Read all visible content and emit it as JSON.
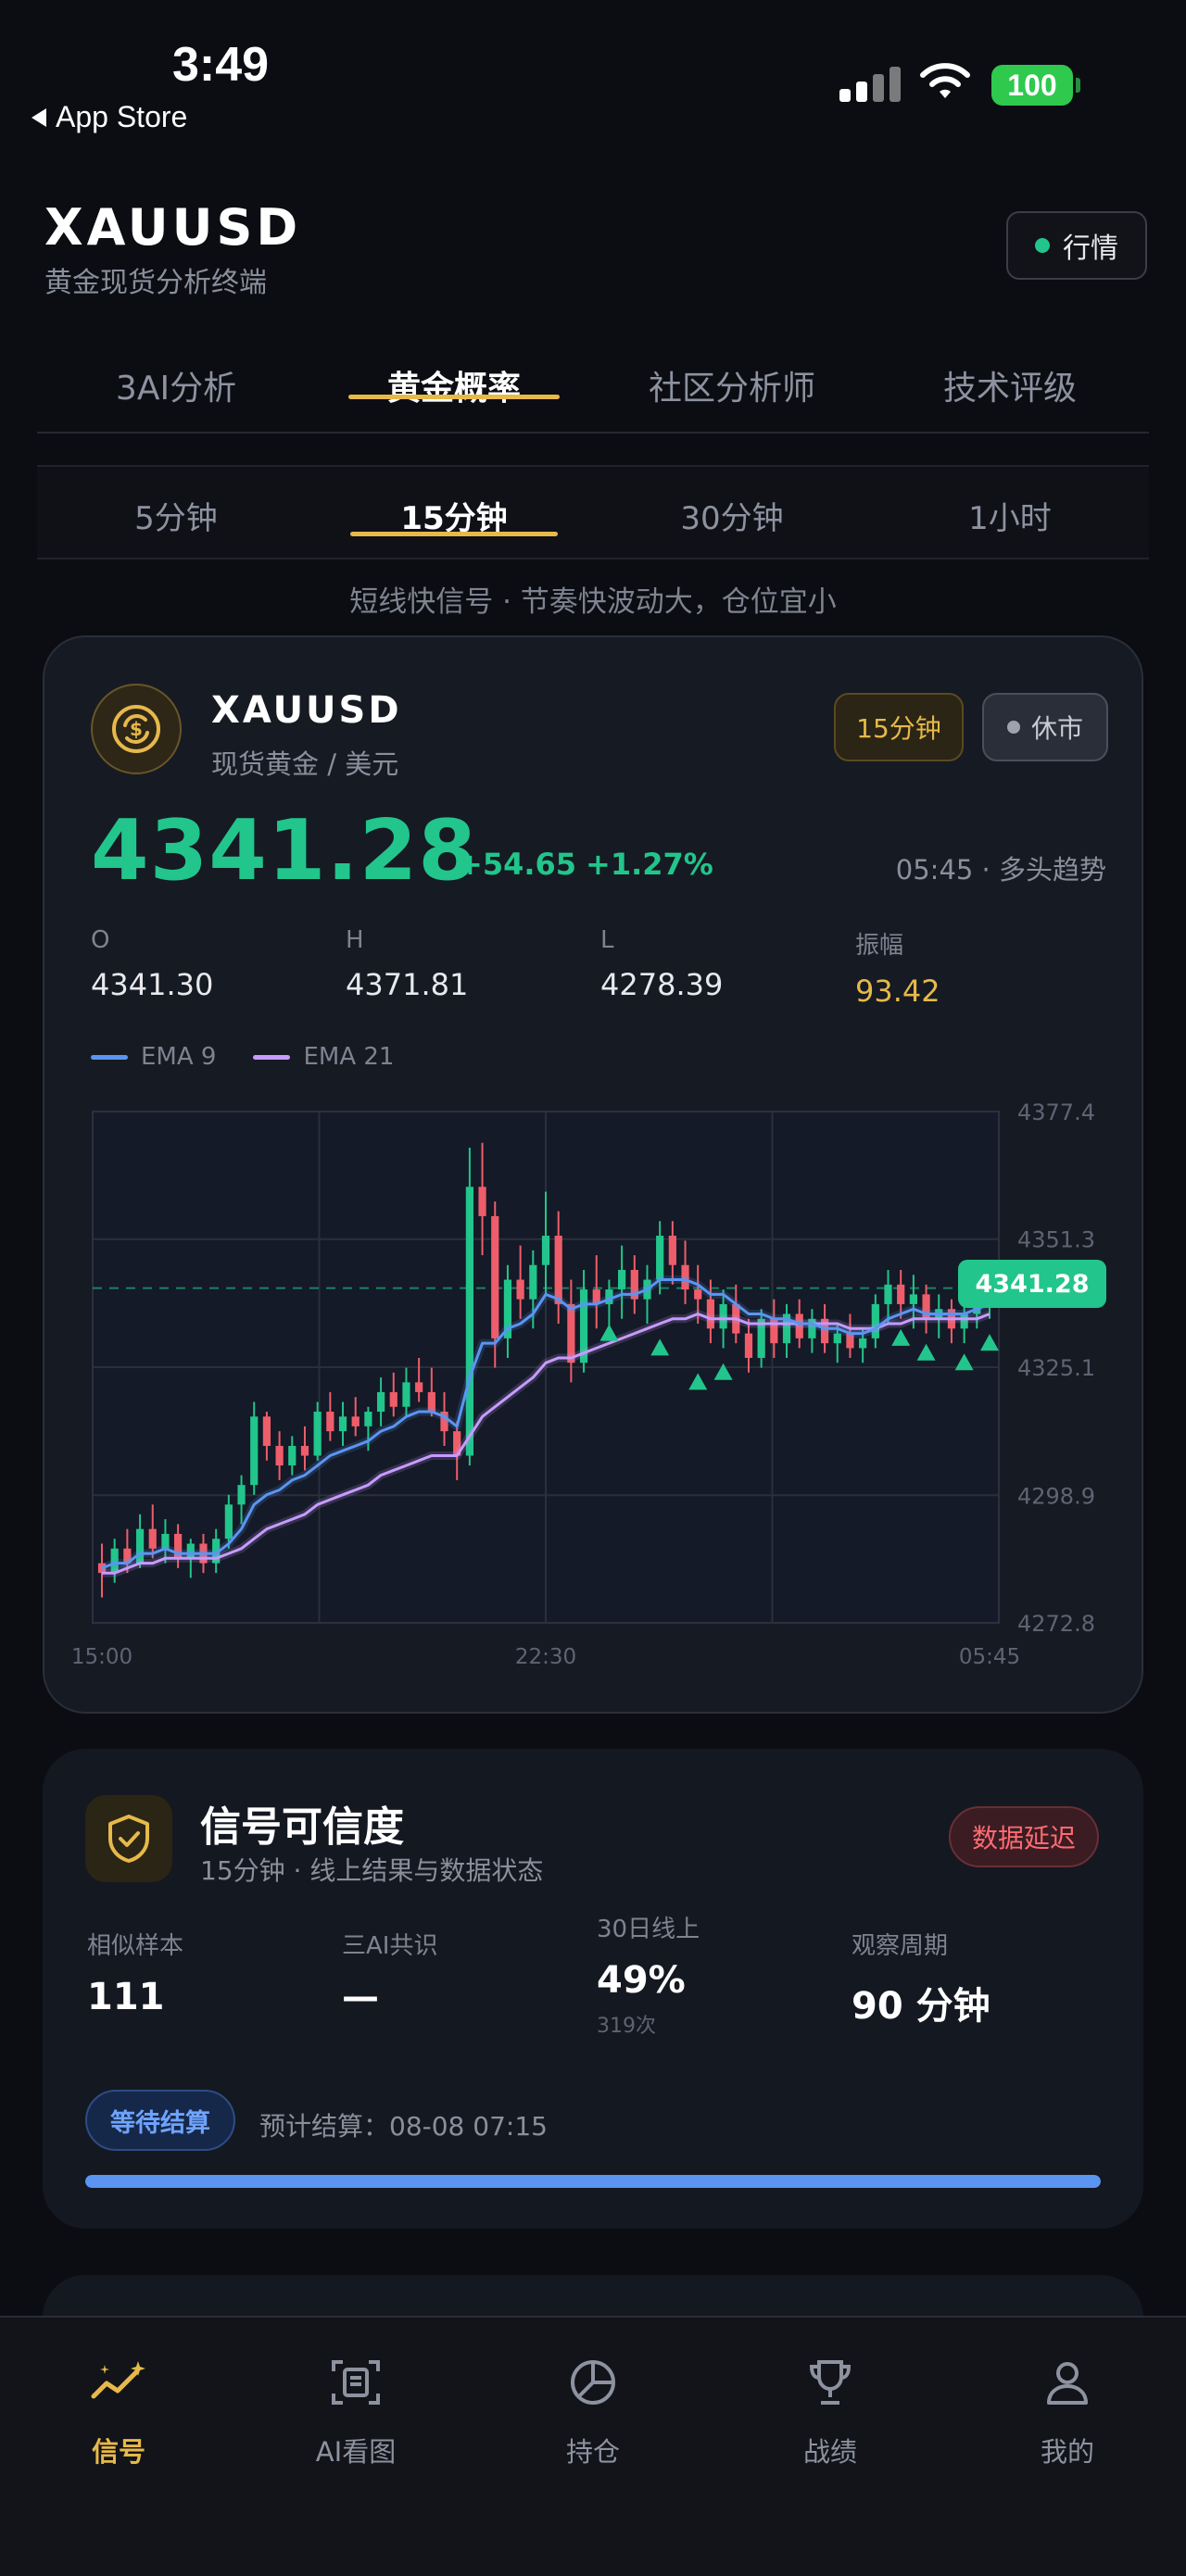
{
  "status_bar": {
    "time": "3:49",
    "back_label": "App Store",
    "battery": "100"
  },
  "header": {
    "title": "XAUUSD",
    "subtitle": "黄金现货分析终端",
    "market_button": "行情"
  },
  "main_tabs": [
    "3AI分析",
    "黄金概率",
    "社区分析师",
    "技术评级"
  ],
  "main_tab_active": "黄金概率",
  "sub_tabs": [
    "5分钟",
    "15分钟",
    "30分钟",
    "1小时"
  ],
  "sub_tab_active": "15分钟",
  "hint": "短线快信号 · 节奏快波动大，仓位宜小",
  "quote": {
    "symbol": "XAUUSD",
    "name": "现货黄金 / 美元",
    "timeframe_badge": "15分钟",
    "market_status": "休市",
    "price": "4341.28",
    "change": "+54.65",
    "change_pct": "+1.27%",
    "trend": "05:45 · 多头趋势",
    "ohlc": [
      {
        "label": "O",
        "value": "4341.30"
      },
      {
        "label": "H",
        "value": "4371.81"
      },
      {
        "label": "L",
        "value": "4278.39"
      },
      {
        "label": "振幅",
        "value": "93.42"
      }
    ],
    "legend": [
      {
        "name": "EMA 9",
        "color": "#5b95f2"
      },
      {
        "name": "EMA 21",
        "color": "#c79bff"
      }
    ]
  },
  "chart_data": {
    "type": "candlestick",
    "y_ticks": [
      "4377.4",
      "4351.3",
      "4325.1",
      "4298.9",
      "4272.8"
    ],
    "ylim": [
      4272.8,
      4377.4
    ],
    "x_ticks": [
      "15:00",
      "22:30",
      "05:45"
    ],
    "last_price_label": "4341.28",
    "last_price": 4341.28,
    "colors": {
      "up": "#22c58b",
      "down": "#ef5d6a",
      "ema9": "#5b95f2",
      "ema21": "#c79bff"
    },
    "candles": [
      [
        4285,
        4289,
        4278,
        4283
      ],
      [
        4283,
        4290,
        4281,
        4288
      ],
      [
        4288,
        4292,
        4283,
        4285
      ],
      [
        4285,
        4295,
        4284,
        4292
      ],
      [
        4292,
        4297,
        4286,
        4288
      ],
      [
        4288,
        4294,
        4285,
        4291
      ],
      [
        4291,
        4293,
        4284,
        4286
      ],
      [
        4286,
        4290,
        4282,
        4289
      ],
      [
        4289,
        4291,
        4283,
        4285
      ],
      [
        4285,
        4292,
        4283,
        4290
      ],
      [
        4290,
        4299,
        4288,
        4297
      ],
      [
        4297,
        4303,
        4293,
        4301
      ],
      [
        4301,
        4318,
        4299,
        4315
      ],
      [
        4315,
        4316,
        4306,
        4309
      ],
      [
        4309,
        4312,
        4302,
        4305
      ],
      [
        4305,
        4311,
        4303,
        4309
      ],
      [
        4309,
        4313,
        4304,
        4307
      ],
      [
        4307,
        4318,
        4306,
        4316
      ],
      [
        4316,
        4320,
        4310,
        4312
      ],
      [
        4312,
        4318,
        4309,
        4315
      ],
      [
        4315,
        4319,
        4311,
        4313
      ],
      [
        4313,
        4317,
        4308,
        4316
      ],
      [
        4316,
        4323,
        4313,
        4320
      ],
      [
        4320,
        4324,
        4315,
        4317
      ],
      [
        4317,
        4325,
        4315,
        4322
      ],
      [
        4322,
        4327,
        4318,
        4320
      ],
      [
        4320,
        4325,
        4315,
        4316
      ],
      [
        4316,
        4320,
        4309,
        4312
      ],
      [
        4312,
        4314,
        4302,
        4307
      ],
      [
        4307,
        4370,
        4305,
        4362
      ],
      [
        4362,
        4371,
        4348,
        4356
      ],
      [
        4356,
        4359,
        4325,
        4331
      ],
      [
        4331,
        4346,
        4327,
        4343
      ],
      [
        4343,
        4350,
        4335,
        4339
      ],
      [
        4339,
        4349,
        4333,
        4346
      ],
      [
        4346,
        4361,
        4340,
        4352
      ],
      [
        4352,
        4357,
        4334,
        4338
      ],
      [
        4338,
        4343,
        4322,
        4326
      ],
      [
        4326,
        4345,
        4324,
        4341
      ],
      [
        4341,
        4348,
        4333,
        4338
      ],
      [
        4338,
        4343,
        4331,
        4341
      ],
      [
        4341,
        4350,
        4335,
        4345
      ],
      [
        4345,
        4348,
        4336,
        4339
      ],
      [
        4339,
        4346,
        4334,
        4343
      ],
      [
        4343,
        4355,
        4340,
        4352
      ],
      [
        4352,
        4355,
        4342,
        4346
      ],
      [
        4346,
        4351,
        4338,
        4341
      ],
      [
        4341,
        4346,
        4334,
        4339
      ],
      [
        4339,
        4343,
        4330,
        4333
      ],
      [
        4333,
        4341,
        4329,
        4338
      ],
      [
        4338,
        4342,
        4330,
        4332
      ],
      [
        4332,
        4335,
        4324,
        4327
      ],
      [
        4327,
        4337,
        4325,
        4335
      ],
      [
        4335,
        4339,
        4327,
        4330
      ],
      [
        4330,
        4338,
        4327,
        4336
      ],
      [
        4336,
        4339,
        4329,
        4331
      ],
      [
        4331,
        4337,
        4328,
        4335
      ],
      [
        4335,
        4338,
        4328,
        4330
      ],
      [
        4330,
        4334,
        4326,
        4332
      ],
      [
        4332,
        4336,
        4327,
        4329
      ],
      [
        4329,
        4333,
        4326,
        4331
      ],
      [
        4331,
        4340,
        4329,
        4338
      ],
      [
        4338,
        4345,
        4334,
        4342
      ],
      [
        4342,
        4345,
        4335,
        4338
      ],
      [
        4338,
        4344,
        4333,
        4340
      ],
      [
        4340,
        4342,
        4332,
        4335
      ],
      [
        4335,
        4340,
        4331,
        4337
      ],
      [
        4337,
        4339,
        4330,
        4333
      ],
      [
        4333,
        4338,
        4330,
        4336
      ],
      [
        4336,
        4340,
        4333,
        4338
      ],
      [
        4338,
        4342,
        4335,
        4341
      ]
    ],
    "ema9": [
      4284,
      4285,
      4285,
      4287,
      4287,
      4288,
      4287,
      4287,
      4287,
      4287,
      4289,
      4292,
      4297,
      4299,
      4300,
      4302,
      4303,
      4305,
      4307,
      4308,
      4309,
      4310,
      4312,
      4313,
      4315,
      4316,
      4316,
      4315,
      4313,
      4323,
      4330,
      4330,
      4333,
      4334,
      4336,
      4340,
      4339,
      4337,
      4338,
      4338,
      4339,
      4340,
      4340,
      4341,
      4343,
      4343,
      4343,
      4342,
      4340,
      4340,
      4338,
      4336,
      4336,
      4335,
      4335,
      4334,
      4334,
      4333,
      4333,
      4332,
      4332,
      4333,
      4335,
      4336,
      4337,
      4336,
      4336,
      4336,
      4336,
      4337,
      4338
    ],
    "ema21": [
      4283,
      4283,
      4284,
      4285,
      4285,
      4286,
      4286,
      4286,
      4286,
      4286,
      4287,
      4288,
      4290,
      4292,
      4293,
      4294,
      4295,
      4297,
      4298,
      4299,
      4300,
      4301,
      4303,
      4304,
      4305,
      4306,
      4307,
      4307,
      4307,
      4311,
      4315,
      4317,
      4319,
      4321,
      4323,
      4326,
      4327,
      4327,
      4328,
      4329,
      4330,
      4331,
      4332,
      4333,
      4334,
      4335,
      4335,
      4336,
      4335,
      4335,
      4335,
      4334,
      4334,
      4334,
      4334,
      4334,
      4334,
      4334,
      4334,
      4333,
      4333,
      4333,
      4334,
      4334,
      4335,
      4335,
      4335,
      4335,
      4335,
      4335,
      4336
    ],
    "signal_markers": [
      {
        "index": 40,
        "price": 4332
      },
      {
        "index": 44,
        "price": 4329
      },
      {
        "index": 47,
        "price": 4322
      },
      {
        "index": 49,
        "price": 4324
      },
      {
        "index": 63,
        "price": 4331
      },
      {
        "index": 65,
        "price": 4328
      },
      {
        "index": 68,
        "price": 4326
      },
      {
        "index": 70,
        "price": 4330
      }
    ]
  },
  "signal": {
    "title": "信号可信度",
    "subtitle": "15分钟 · 线上结果与数据状态",
    "delay_badge": "数据延迟",
    "stats": [
      {
        "label": "相似样本",
        "value": "111",
        "note": ""
      },
      {
        "label": "三AI共识",
        "value": "—",
        "note": ""
      },
      {
        "label": "30日线上",
        "value": "49%",
        "note": "319次"
      },
      {
        "label": "观察周期",
        "value": "90 分钟",
        "note": ""
      }
    ],
    "wait_badge": "等待结算",
    "settle_text": "预计结算：08-08 07:15",
    "progress": 1.0
  },
  "bottom_nav": [
    {
      "label": "信号",
      "icon": "sparkline-icon",
      "active": true
    },
    {
      "label": "AI看图",
      "icon": "scan-icon",
      "active": false
    },
    {
      "label": "持仓",
      "icon": "pie-icon",
      "active": false
    },
    {
      "label": "战绩",
      "icon": "trophy-icon",
      "active": false
    },
    {
      "label": "我的",
      "icon": "user-icon",
      "active": false
    }
  ],
  "accent_colors": {
    "gold": "#e6b94a",
    "green": "#22c58b",
    "red": "#ef5d6a",
    "blue": "#5b95f2"
  }
}
